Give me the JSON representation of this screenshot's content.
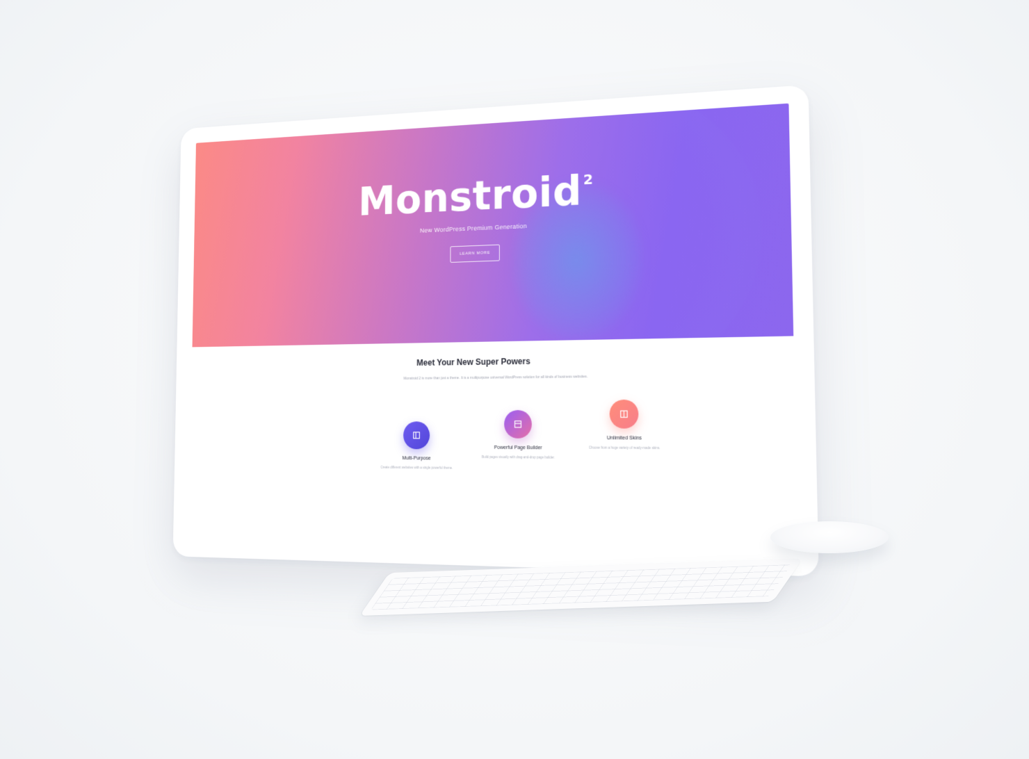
{
  "hero": {
    "title": "Monstroid",
    "title_superscript": "2",
    "subtitle": "New WordPress Premium Generation",
    "button_label": "LEARN MORE"
  },
  "section": {
    "title": "Meet Your New Super Powers",
    "description": "Monstroid 2 is more than just a theme. It is a multipurpose universal WordPress solution for all kinds of business websites."
  },
  "features": [
    {
      "title": "Multi-Purpose",
      "description": "Create different websites with a single powerful theme.",
      "icon": "layout-icon",
      "color": "#5f51e6"
    },
    {
      "title": "Powerful Page Builder",
      "description": "Build pages visually with drag-and-drop page builder.",
      "icon": "builder-icon",
      "color": "#b866d0"
    },
    {
      "title": "Unlimited Skins",
      "description": "Choose from a huge variety of ready-made skins.",
      "icon": "skins-icon",
      "color": "#fb8580"
    }
  ],
  "colors": {
    "hero_start": "#fb8a86",
    "hero_end": "#8a66f1",
    "background": "#f5f7f9"
  }
}
